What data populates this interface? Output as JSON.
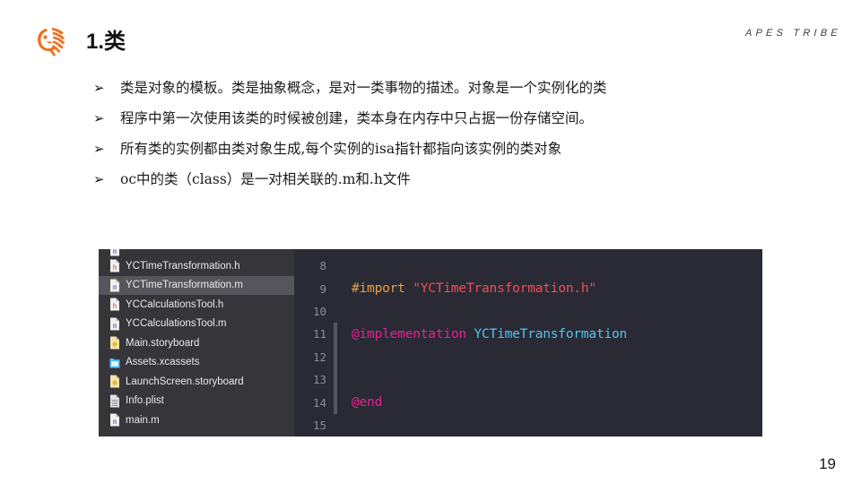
{
  "slide": {
    "title": "1.类",
    "brand": "APES TRIBE",
    "logo_icon": "ape-head-logo-icon",
    "page_number": "19",
    "accent_color": "#f07020"
  },
  "bullets": [
    {
      "glyph": "➢",
      "text": "类是对象的模板。类是抽象概念，是对一类事物的描述。对象是一个实例化的类"
    },
    {
      "glyph": "➢",
      "text": "程序中第一次使用该类的时候被创建，类本身在内存中只占据一份存储空间。"
    },
    {
      "glyph": "➢",
      "text": "所有类的实例都由类对象生成,每个实例的isa指针都指向该实例的类对象"
    },
    {
      "glyph": "➢",
      "text": "oc中的类（class）是一对相关联的.m和.h文件"
    }
  ],
  "xcode": {
    "navigator": {
      "background_color": "#363539",
      "selected_color": "#56555b",
      "files": [
        {
          "name": "",
          "icon": "objc-implementation-file-icon",
          "selected": false,
          "clipped": true
        },
        {
          "name": "YCTimeTransformation.h",
          "icon": "objc-header-file-icon",
          "selected": false,
          "clipped": false
        },
        {
          "name": "YCTimeTransformation.m",
          "icon": "objc-implementation-file-icon",
          "selected": true,
          "clipped": false
        },
        {
          "name": "YCCalculationsTool.h",
          "icon": "objc-header-file-icon",
          "selected": false,
          "clipped": false
        },
        {
          "name": "YCCalculationsTool.m",
          "icon": "objc-implementation-file-icon",
          "selected": false,
          "clipped": false
        },
        {
          "name": "Main.storyboard",
          "icon": "storyboard-file-icon",
          "selected": false,
          "clipped": false
        },
        {
          "name": "Assets.xcassets",
          "icon": "asset-catalog-folder-icon",
          "selected": false,
          "clipped": false
        },
        {
          "name": "LaunchScreen.storyboard",
          "icon": "storyboard-file-icon",
          "selected": false,
          "clipped": false
        },
        {
          "name": "Info.plist",
          "icon": "plist-file-icon",
          "selected": false,
          "clipped": false
        },
        {
          "name": "main.m",
          "icon": "objc-implementation-file-icon",
          "selected": false,
          "clipped": false
        }
      ]
    },
    "editor": {
      "background_color": "#2a2a35",
      "gutter_color": "#8d8d99",
      "lines": [
        {
          "number": "8",
          "block": false,
          "tokens": []
        },
        {
          "number": "9",
          "block": false,
          "tokens": [
            {
              "kind": "pre",
              "text": "#import "
            },
            {
              "kind": "str",
              "text": "\"YCTimeTransformation.h\""
            }
          ]
        },
        {
          "number": "10",
          "block": false,
          "tokens": []
        },
        {
          "number": "11",
          "block": true,
          "tokens": [
            {
              "kind": "kw",
              "text": "@implementation "
            },
            {
              "kind": "type",
              "text": "YCTimeTransformation"
            }
          ]
        },
        {
          "number": "12",
          "block": true,
          "tokens": []
        },
        {
          "number": "13",
          "block": true,
          "tokens": []
        },
        {
          "number": "14",
          "block": true,
          "tokens": [
            {
              "kind": "kw",
              "text": "@end"
            }
          ]
        },
        {
          "number": "15",
          "block": false,
          "tokens": []
        }
      ]
    }
  }
}
